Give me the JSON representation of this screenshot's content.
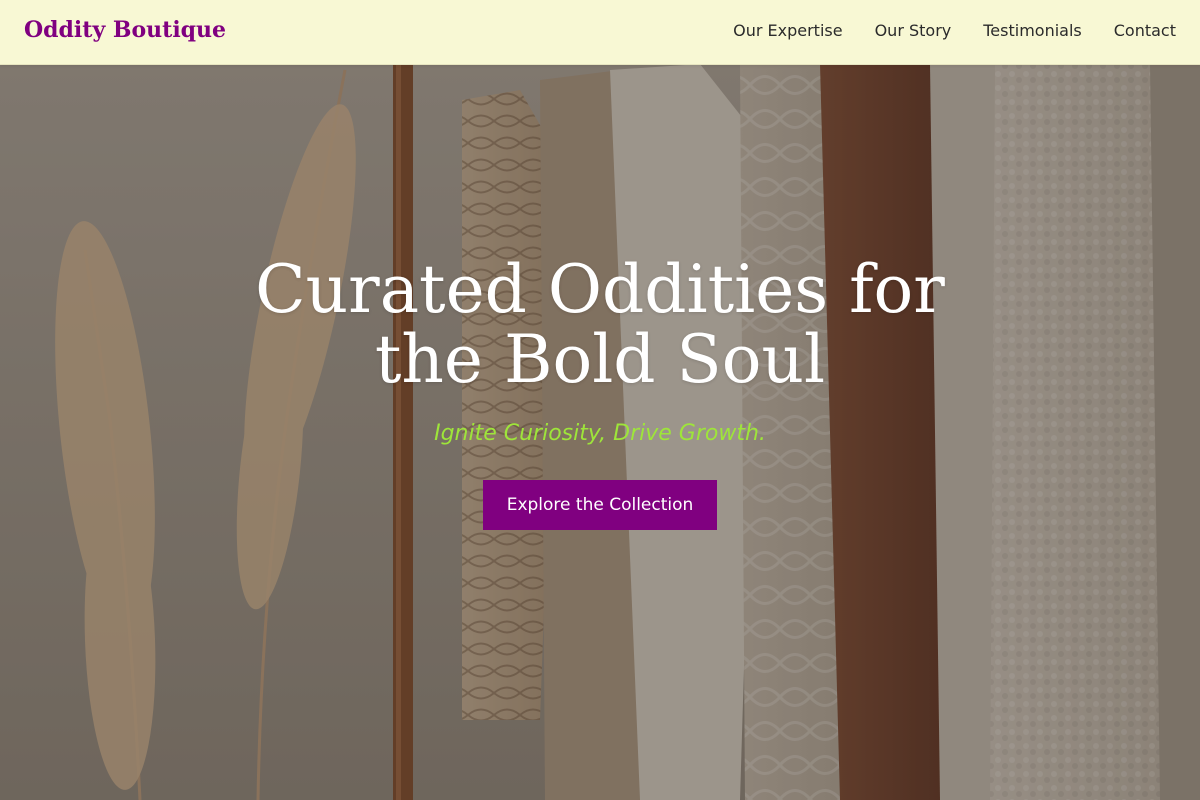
{
  "header": {
    "brand": "Oddity Boutique",
    "nav": [
      {
        "label": "Our Expertise"
      },
      {
        "label": "Our Story"
      },
      {
        "label": "Testimonials"
      },
      {
        "label": "Contact"
      }
    ]
  },
  "hero": {
    "title": "Curated Oddities for the Bold Soul",
    "tagline": "Ignite Curiosity, Drive Growth.",
    "cta_label": "Explore the Collection"
  },
  "colors": {
    "brand": "#800080",
    "header_bg": "#f8f8d4",
    "tagline": "#9ee53a",
    "cta_bg": "#800080"
  }
}
